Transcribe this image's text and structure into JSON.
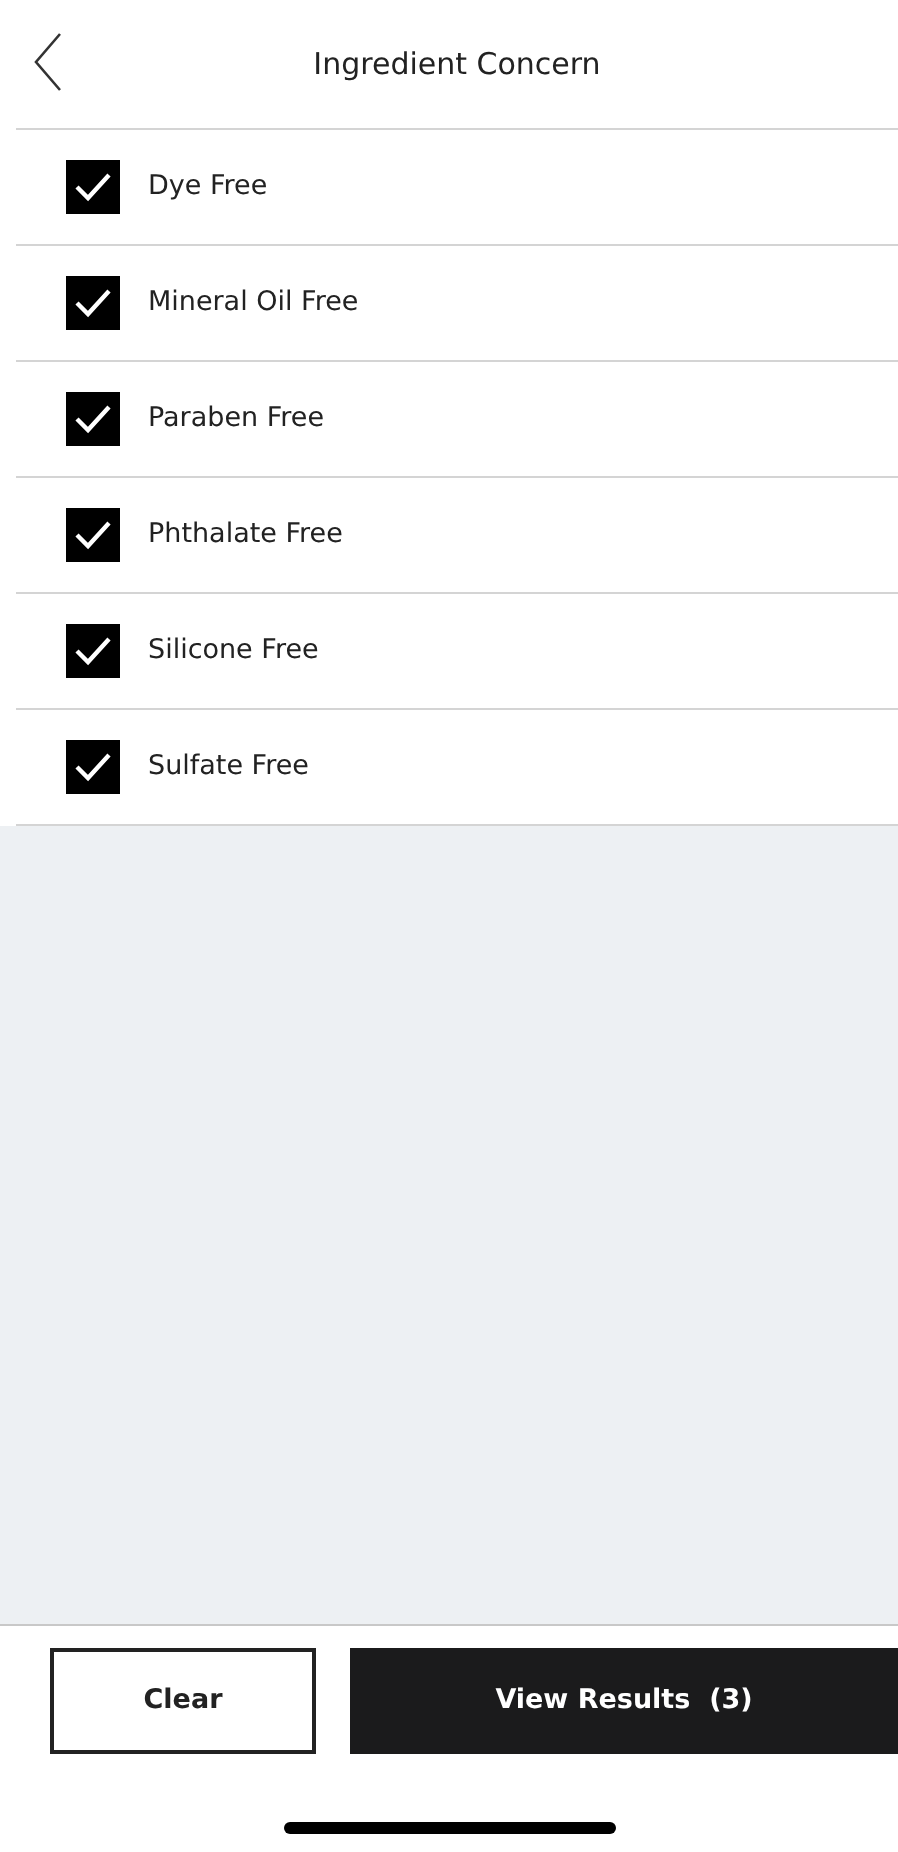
{
  "header": {
    "title": "Ingredient Concern"
  },
  "options": [
    {
      "label": "Dye Free",
      "checked": true
    },
    {
      "label": "Mineral Oil Free",
      "checked": true
    },
    {
      "label": "Paraben Free",
      "checked": true
    },
    {
      "label": "Phthalate Free",
      "checked": true
    },
    {
      "label": "Silicone Free",
      "checked": true
    },
    {
      "label": "Sulfate Free",
      "checked": true
    }
  ],
  "footer": {
    "clear_button": "Clear",
    "results_button": "View Results  (3)"
  }
}
